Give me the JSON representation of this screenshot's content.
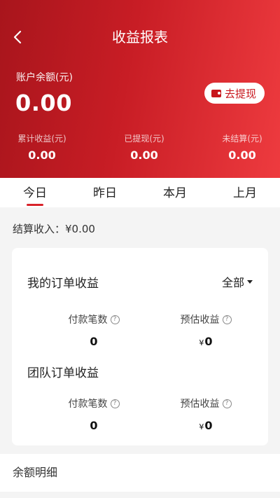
{
  "header": {
    "title": "收益报表",
    "back_icon": "chevron-left-icon",
    "balance_label": "账户余额(元)",
    "balance_value": "0.00",
    "withdraw_label": "去提现",
    "withdraw_icon": "wallet-icon",
    "stats": [
      {
        "label": "累计收益(元)",
        "value": "0.00"
      },
      {
        "label": "已提现(元)",
        "value": "0.00"
      },
      {
        "label": "未结算(元)",
        "value": "0.00"
      }
    ],
    "colors": {
      "gradient_start": "#a8151c",
      "gradient_end": "#ee3b3f"
    }
  },
  "tabs": [
    {
      "label": "今日",
      "active": true
    },
    {
      "label": "昨日",
      "active": false
    },
    {
      "label": "本月",
      "active": false
    },
    {
      "label": "上月",
      "active": false
    }
  ],
  "settlement": {
    "label": "结算收入：",
    "value": "¥0.00"
  },
  "card": {
    "my_orders": {
      "title": "我的订单收益",
      "filter": "全部",
      "paid_label": "付款笔数",
      "paid_value": "0",
      "estimate_label": "预估收益",
      "estimate_currency": "¥",
      "estimate_value": "0"
    },
    "team_orders": {
      "title": "团队订单收益",
      "paid_label": "付款笔数",
      "paid_value": "0",
      "estimate_label": "预估收益",
      "estimate_currency": "¥",
      "estimate_value": "0"
    },
    "help_icon": "question-circle-icon",
    "help_glyph": "?"
  },
  "balance_detail": {
    "label": "余额明细"
  }
}
